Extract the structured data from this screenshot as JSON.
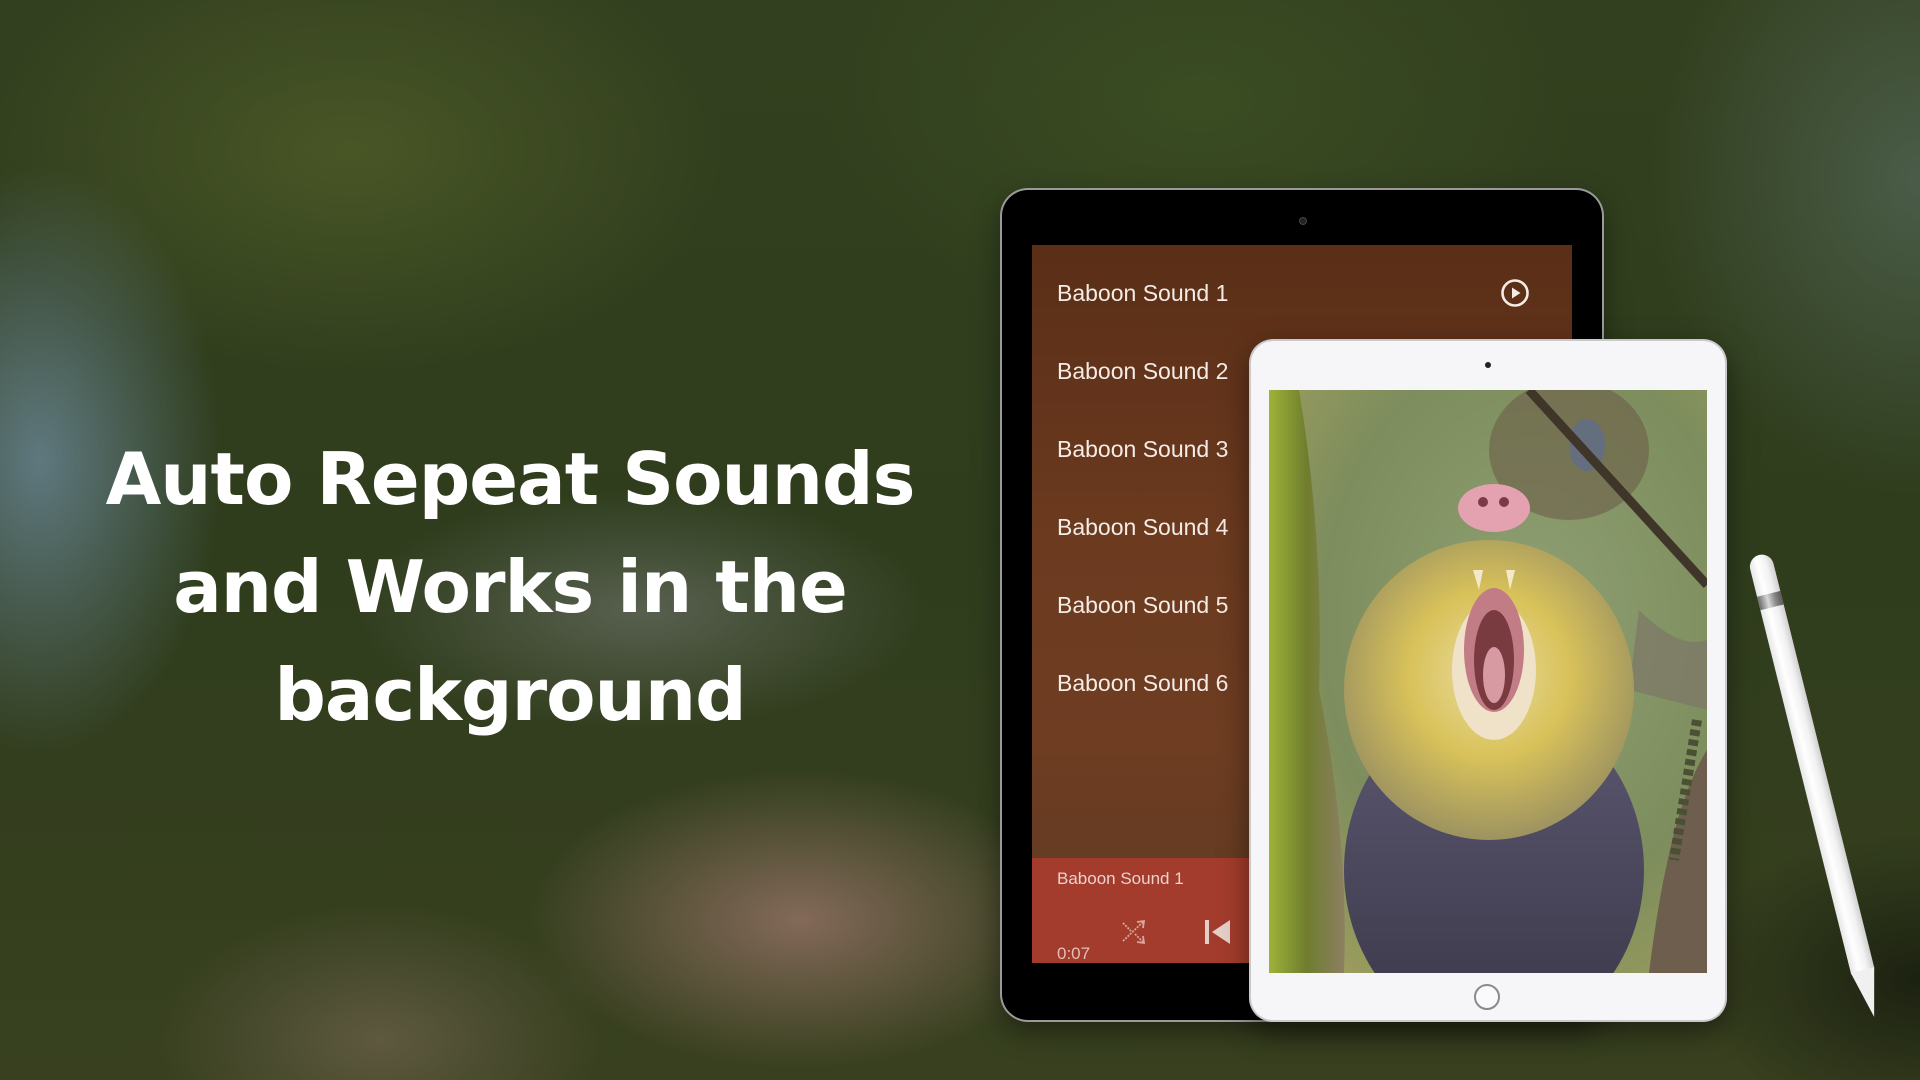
{
  "headline": {
    "lines": [
      "Auto Repeat Sounds",
      "and Works in the",
      "background"
    ]
  },
  "app": {
    "sounds": [
      {
        "label": "Baboon Sound 1",
        "icon": "play-circle-icon"
      },
      {
        "label": "Baboon Sound 2"
      },
      {
        "label": "Baboon Sound 3"
      },
      {
        "label": "Baboon Sound 4"
      },
      {
        "label": "Baboon Sound 5"
      },
      {
        "label": "Baboon Sound 6"
      }
    ],
    "player": {
      "now_playing": "Baboon Sound 1",
      "elapsed": "0:07",
      "controls": [
        "shuffle-icon",
        "previous-track-icon"
      ],
      "accent_color": "#a33c2c"
    },
    "list_background_color": "#5e3420"
  },
  "devices": {
    "tablet_dark_color": "#000000",
    "tablet_light_color": "#f6f6f8",
    "photo_subject": "mandrill yawning"
  }
}
